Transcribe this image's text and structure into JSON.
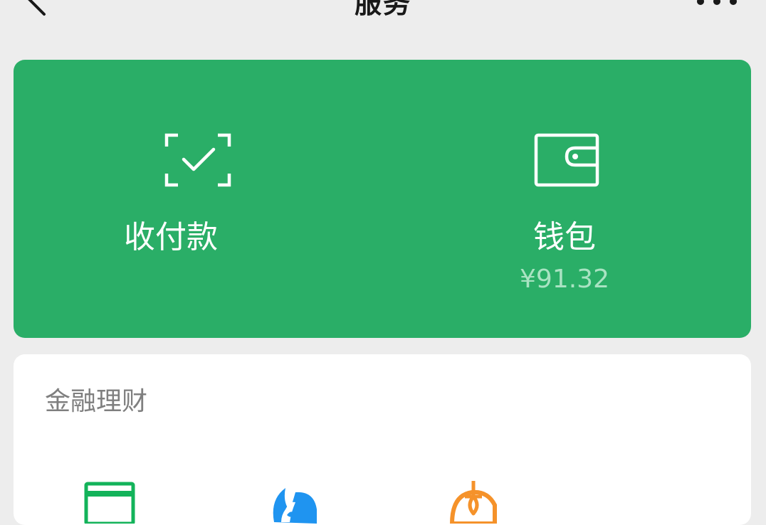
{
  "header": {
    "title": "服务",
    "back_icon": "chevron-left-icon",
    "more_icon": "more-dots-icon"
  },
  "payment_card": {
    "background_color": "#2aae67",
    "items": [
      {
        "label": "收付款",
        "icon": "scan-pay-icon"
      },
      {
        "label": "钱包",
        "icon": "wallet-icon",
        "amount": "¥91.32"
      }
    ]
  },
  "finance_section": {
    "title": "金融理财",
    "apps": [
      {
        "icon": "credit-card-icon",
        "color": "#13b35a"
      },
      {
        "icon": "licaitong-icon",
        "color": "#1f94f0"
      },
      {
        "icon": "insurance-icon",
        "color": "#f5922a"
      }
    ]
  }
}
